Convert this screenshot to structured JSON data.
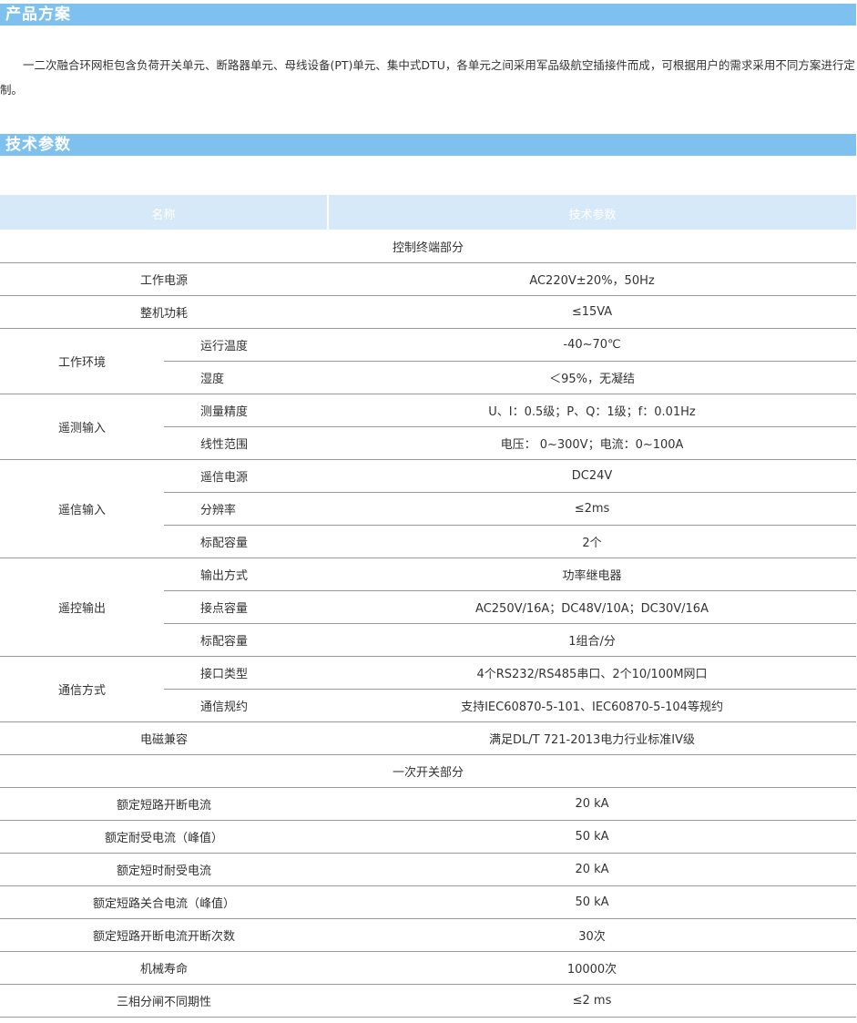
{
  "sections": {
    "product": "产品方案",
    "specs": "技术参数"
  },
  "intro": "一二次融合环网柜包含负荷开关单元、断路器单元、母线设备(PT)单元、集中式DTU，各单元之间采用军品级航空插接件而成，可根据用户的需求采用不同方案进行定制。",
  "table": {
    "headers": {
      "name": "名称",
      "value": "技术参数"
    },
    "control_section": "控制终端部分",
    "power_supply": {
      "label": "工作电源",
      "value": "AC220V±20%，50Hz"
    },
    "power_consumption": {
      "label": "整机功耗",
      "value": "≤15VA"
    },
    "environment": {
      "label": "工作环境",
      "rows": [
        {
          "label": "运行温度",
          "value": "-40~70℃"
        },
        {
          "label": "湿度",
          "value": "＜95%，无凝结"
        }
      ]
    },
    "telemetry": {
      "label": "遥测输入",
      "rows": [
        {
          "label": "测量精度",
          "value": "U、I：0.5级；P、Q：1级；f：0.01Hz"
        },
        {
          "label": "线性范围",
          "value": "电压： 0~300V；电流：0~100A"
        }
      ]
    },
    "telesignal": {
      "label": "遥信输入",
      "rows": [
        {
          "label": "遥信电源",
          "value": "DC24V"
        },
        {
          "label": "分辨率",
          "value": "≤2ms"
        },
        {
          "label": "标配容量",
          "value": "2个"
        }
      ]
    },
    "telecontrol": {
      "label": "遥控输出",
      "rows": [
        {
          "label": "输出方式",
          "value": "功率继电器"
        },
        {
          "label": "接点容量",
          "value": "AC250V/16A；DC48V/10A；DC30V/16A"
        },
        {
          "label": "标配容量",
          "value": "1组合/分"
        }
      ]
    },
    "communication": {
      "label": "通信方式",
      "rows": [
        {
          "label": "接口类型",
          "value": "4个RS232/RS485串口、2个10/100M网口"
        },
        {
          "label": "通信规约",
          "value": "支持IEC60870-5-101、IEC60870-5-104等规约"
        }
      ]
    },
    "emc": {
      "label": "电磁兼容",
      "value": "满足DL/T 721-2013电力行业标准IV级"
    },
    "primary_section": "一次开关部分",
    "primary_rows": [
      {
        "label": "额定短路开断电流",
        "value": "20 kA"
      },
      {
        "label": "额定耐受电流（峰值）",
        "value": "50 kA"
      },
      {
        "label": "额定短时耐受电流",
        "value": "20 kA"
      },
      {
        "label": "额定短路关合电流（峰值）",
        "value": "50 kA"
      },
      {
        "label": "额定短路开断电流开断次数",
        "value": "30次"
      },
      {
        "label": "机械寿命",
        "value": "10000次"
      },
      {
        "label": "三相分闸不同期性",
        "value": "≤2 ms"
      }
    ]
  }
}
